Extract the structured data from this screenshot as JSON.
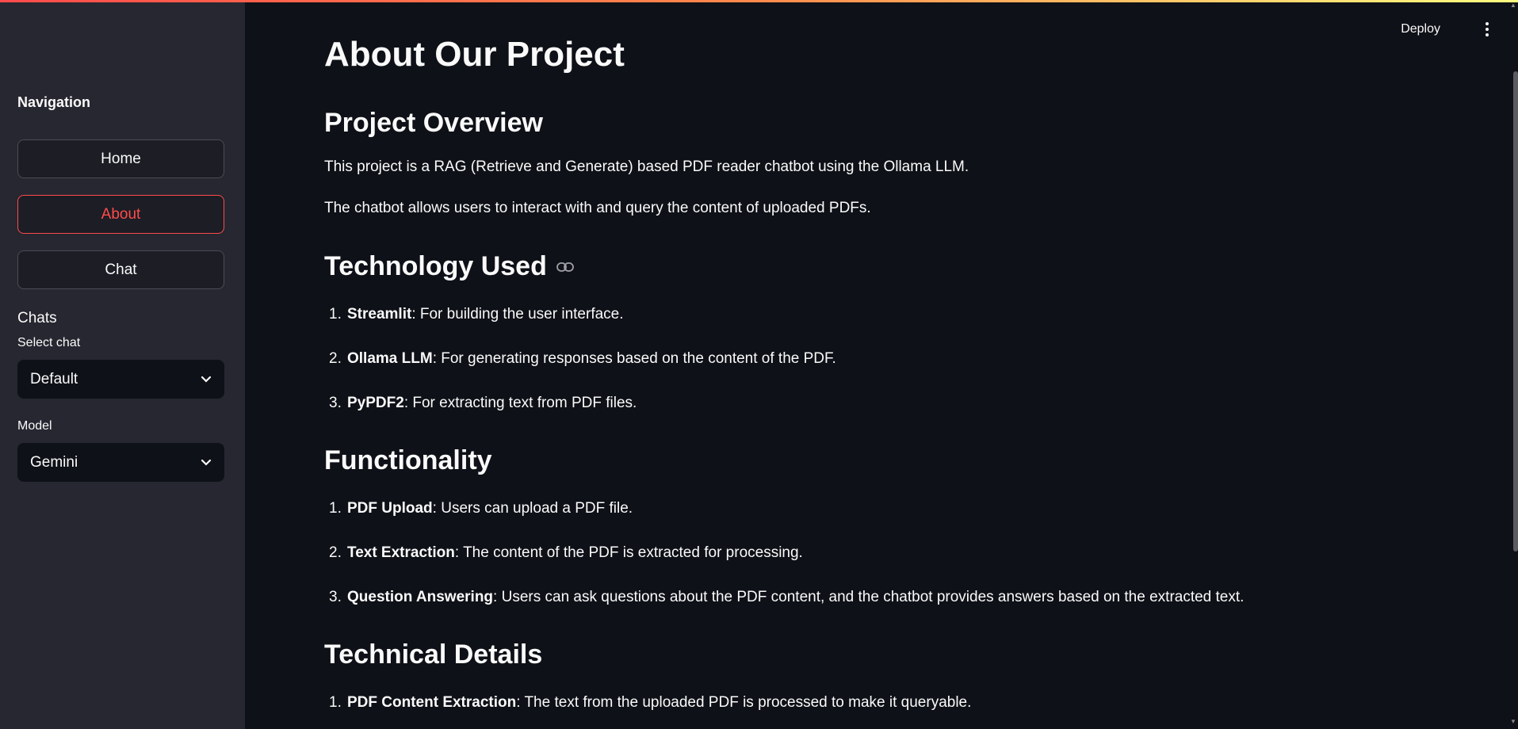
{
  "sidebar": {
    "nav_title": "Navigation",
    "buttons": [
      {
        "label": "Home",
        "active": false
      },
      {
        "label": "About",
        "active": true
      },
      {
        "label": "Chat",
        "active": false
      }
    ],
    "chats_heading": "Chats",
    "select_chat_label": "Select chat",
    "select_chat_value": "Default",
    "model_label": "Model",
    "model_value": "Gemini"
  },
  "header": {
    "deploy_label": "Deploy",
    "menu_icon": "kebab-menu-icon"
  },
  "main": {
    "title": "About Our Project",
    "overview": {
      "heading": "Project Overview",
      "paragraphs": [
        "This project is a RAG (Retrieve and Generate) based PDF reader chatbot using the Ollama LLM.",
        "The chatbot allows users to interact with and query the content of uploaded PDFs."
      ]
    },
    "technology": {
      "heading": "Technology Used",
      "items": [
        {
          "num": "1.",
          "term": "Streamlit",
          "desc": ": For building the user interface."
        },
        {
          "num": "2.",
          "term": "Ollama LLM",
          "desc": ": For generating responses based on the content of the PDF."
        },
        {
          "num": "3.",
          "term": "PyPDF2",
          "desc": ": For extracting text from PDF files."
        }
      ]
    },
    "functionality": {
      "heading": "Functionality",
      "items": [
        {
          "num": "1.",
          "term": "PDF Upload",
          "desc": ": Users can upload a PDF file."
        },
        {
          "num": "2.",
          "term": "Text Extraction",
          "desc": ": The content of the PDF is extracted for processing."
        },
        {
          "num": "3.",
          "term": "Question Answering",
          "desc": ": Users can ask questions about the PDF content, and the chatbot provides answers based on the extracted text."
        }
      ]
    },
    "technical": {
      "heading": "Technical Details",
      "items": [
        {
          "num": "1.",
          "term": "PDF Content Extraction",
          "desc": ": The text from the uploaded PDF is processed to make it queryable."
        }
      ]
    }
  },
  "colors": {
    "background": "#0e1117",
    "sidebar": "#262730",
    "accent": "#ff4b4b",
    "text": "#fafafa"
  }
}
